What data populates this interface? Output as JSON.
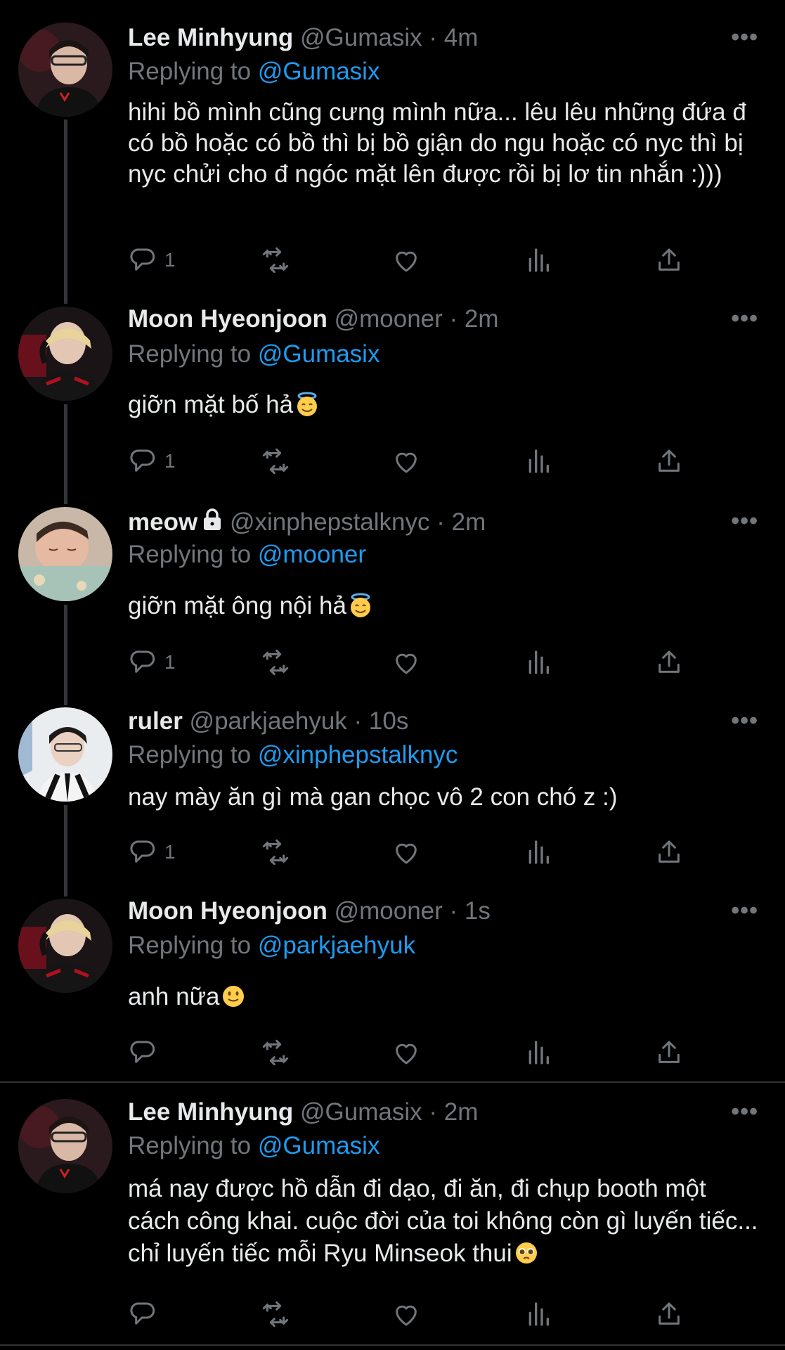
{
  "tweets": [
    {
      "name": "Lee Minhyung",
      "meta": "@Gumasix · 4m",
      "replying_label": "Replying to",
      "replying_handle": "@Gumasix",
      "text": "hihi bồ mình cũng cưng mình nữa... lêu lêu những đứa đ có bồ hoặc có bồ thì bị bồ giận do ngu hoặc có nyc thì bị nyc chửi cho đ ngóc mặt lên được rồi bị lơ tin nhắn :)))",
      "reply_count": "1",
      "more_label": "•••"
    },
    {
      "name": "Moon Hyeonjoon",
      "meta": "@mooner · 2m",
      "replying_label": "Replying to",
      "replying_handle": "@Gumasix",
      "text": "giỡn mặt bố hả",
      "emoji": "smiling-face-with-halo",
      "reply_count": "1",
      "more_label": "•••"
    },
    {
      "name": "meow",
      "lock_icon": "lock-icon",
      "meta": "@xinphepstalknyc · 2m",
      "replying_label": "Replying to",
      "replying_handle": "@mooner",
      "text": "giỡn mặt ông nội hả",
      "emoji": "smiling-face-with-halo",
      "reply_count": "1",
      "more_label": "•••"
    },
    {
      "name": "ruler",
      "meta": "@parkjaehyuk · 10s",
      "replying_label": "Replying to",
      "replying_handle": "@xinphepstalknyc",
      "text": "nay mày ăn gì mà gan chọc vô 2 con chó z :)",
      "reply_count": "1",
      "more_label": "•••"
    },
    {
      "name": "Moon Hyeonjoon",
      "meta": "@mooner · 1s",
      "replying_label": "Replying to",
      "replying_handle": "@parkjaehyuk",
      "text": "anh nữa",
      "emoji": "slightly-smiling-face",
      "reply_count": "",
      "more_label": "•••"
    },
    {
      "name": "Lee Minhyung",
      "meta": "@Gumasix · 2m",
      "replying_label": "Replying to",
      "replying_handle": "@Gumasix",
      "text": "má nay được hồ dẫn đi dạo, đi ăn, đi chụp booth một cách công khai. cuộc đời của toi không còn gì luyến tiếc... chỉ luyến tiếc mỗi Ryu Minseok thui",
      "emoji": "pleading-face",
      "reply_count": "",
      "more_label": "•••"
    }
  ],
  "icons": [
    "reply-icon",
    "retweet-icon",
    "like-icon",
    "views-icon",
    "share-icon",
    "more-icon"
  ],
  "colors": {
    "background": "#000000",
    "text": "#e7e9ea",
    "muted": "#71767b",
    "accent": "#1d9bf0",
    "divider": "#2f3336"
  }
}
